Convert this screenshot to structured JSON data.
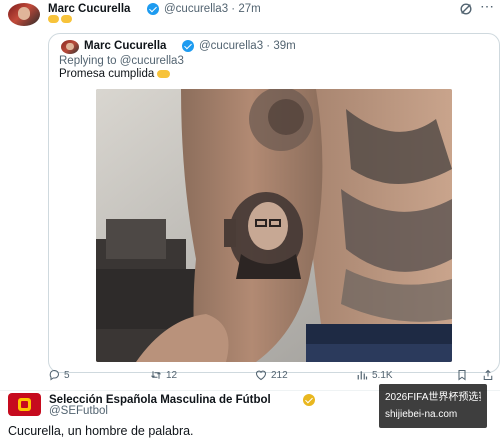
{
  "main_tweet": {
    "author_name": "Marc Cucurella",
    "handle": "@cucurella3",
    "time": "27m",
    "emojis": [
      "clap-emoji",
      "clap-emoji"
    ]
  },
  "quoted_tweet": {
    "author_name": "Marc Cucurella",
    "handle": "@cucurella3",
    "time": "39m",
    "replying_prefix": "Replying to",
    "replying_handle": "@cucurella3",
    "text": "Promesa cumplida",
    "text_emoji": "clap-emoji",
    "image_description_icon": "tattoo-photo"
  },
  "actions": {
    "replies": "5",
    "retweets": "12",
    "likes": "212",
    "views": "5.1K"
  },
  "second_tweet": {
    "author_name": "Selección Española Masculina de Fútbol",
    "handle": "@SEFutbol",
    "text": "Cucurella, un hombre de palabra."
  },
  "watermark": {
    "line1": "2026FIFA世界杯预选赛",
    "line2": "shijiebei-na.com"
  },
  "colors": {
    "accent": "#1d9bf0",
    "gold_verified": "#e9b71f",
    "text": "#0f1419",
    "muted": "#536471",
    "border": "#cfd9de"
  }
}
